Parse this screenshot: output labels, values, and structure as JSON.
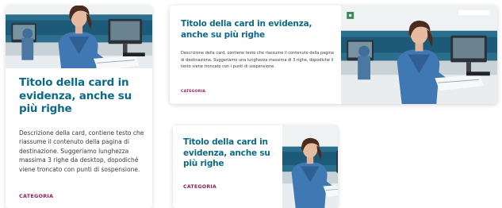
{
  "cards": [
    {
      "title": "Titolo della card in evidenza, anche su più righe",
      "description": "Descrizione della card, contiene testo che riassume il contenuto della pagina di destinazione. Suggeriamo lunghezza massima 3 righe da desktop, dopodiché viene troncato con punti di sospensione.",
      "category": "CATEGORIA",
      "image_icon": "doctor-photo"
    },
    {
      "title": "Titolo della card in evidenza, anche su più righe",
      "description": "Descrizione della card, contiene testo che riassume il contenuto della pagina di destinazione. Suggeriamo una lunghezza massima di 3 righe, dopodiché il testo viene troncato con i punti di sospensione.",
      "category": "CATEGORIA",
      "image_icon": "doctor-photo"
    },
    {
      "title": "Titolo della card in evidenza, anche su più righe",
      "category": "CATEGORIA",
      "image_icon": "doctor-photo"
    }
  ],
  "colors": {
    "title": "#0d6a86",
    "category": "#8e1f5f",
    "text": "#3a3a3a"
  }
}
